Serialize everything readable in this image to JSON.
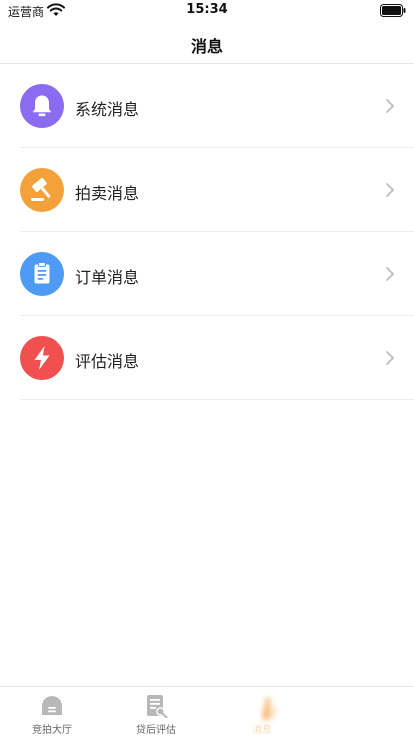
{
  "status_bar": {
    "carrier": "运营商",
    "time": "15:34"
  },
  "nav": {
    "title": "消息"
  },
  "messages": [
    {
      "label": "系统消息",
      "icon": "bell-icon",
      "color": "#8b6cf0"
    },
    {
      "label": "拍卖消息",
      "icon": "gavel-icon",
      "color": "#f5a13a"
    },
    {
      "label": "订单消息",
      "icon": "clipboard-icon",
      "color": "#4e9bf5"
    },
    {
      "label": "评估消息",
      "icon": "lightning-icon",
      "color": "#f0504f"
    }
  ],
  "tabs": [
    {
      "label": "竞拍大厅",
      "icon": "auction-hall-icon"
    },
    {
      "label": "贷后评估",
      "icon": "report-search-icon"
    },
    {
      "label": "消息",
      "icon": "message-icon",
      "active": true
    }
  ],
  "colors": {
    "accent": "#f29a3a",
    "tab_inactive": "#b8b8b8"
  }
}
